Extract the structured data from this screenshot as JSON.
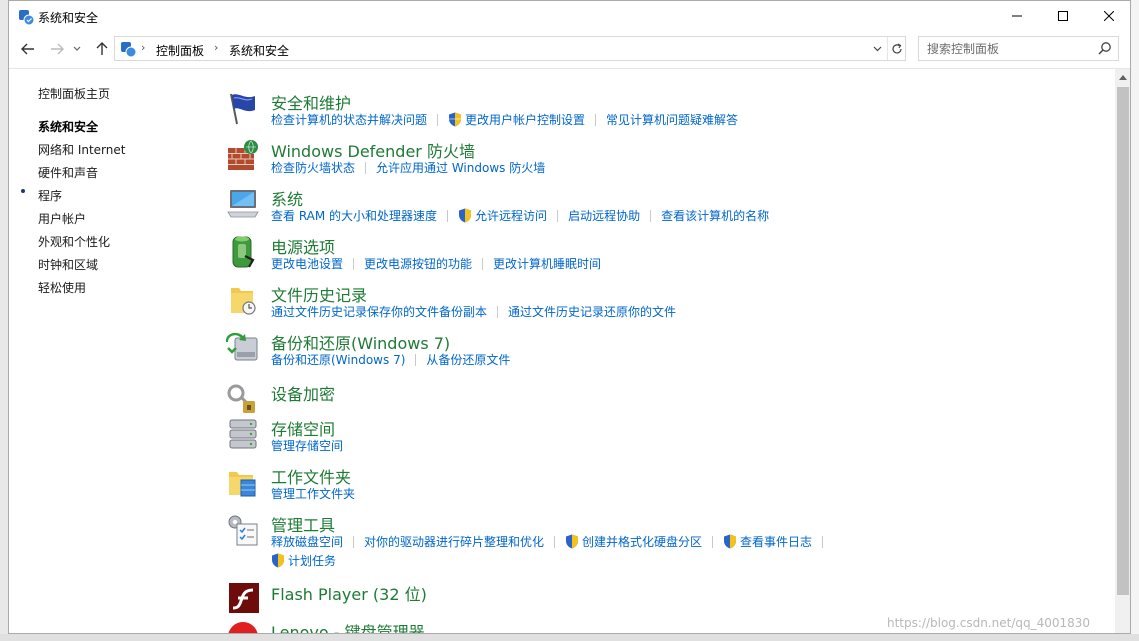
{
  "window": {
    "title": "系统和安全"
  },
  "address": {
    "crumbs": [
      "控制面板",
      "系统和安全"
    ]
  },
  "search": {
    "placeholder": "搜索控制面板"
  },
  "leftnav": {
    "home": "控制面板主页",
    "items": [
      "系统和安全",
      "网络和 Internet",
      "硬件和声音",
      "程序",
      "用户帐户",
      "外观和个性化",
      "时钟和区域",
      "轻松使用"
    ],
    "current_index": 0
  },
  "categories": [
    {
      "title": "安全和维护",
      "icon": "flag-icon",
      "links": [
        {
          "text": "检查计算机的状态并解决问题",
          "shield": false
        },
        {
          "text": "更改用户帐户控制设置",
          "shield": true
        },
        {
          "text": "常见计算机问题疑难解答",
          "shield": false
        }
      ]
    },
    {
      "title": "Windows Defender 防火墙",
      "icon": "firewall-icon",
      "links": [
        {
          "text": "检查防火墙状态",
          "shield": false
        },
        {
          "text": "允许应用通过 Windows 防火墙",
          "shield": false
        }
      ]
    },
    {
      "title": "系统",
      "icon": "computer-icon",
      "links": [
        {
          "text": "查看 RAM 的大小和处理器速度",
          "shield": false
        },
        {
          "text": "允许远程访问",
          "shield": true
        },
        {
          "text": "启动远程协助",
          "shield": false
        },
        {
          "text": "查看该计算机的名称",
          "shield": false
        }
      ]
    },
    {
      "title": "电源选项",
      "icon": "battery-icon",
      "links": [
        {
          "text": "更改电池设置",
          "shield": false
        },
        {
          "text": "更改电源按钮的功能",
          "shield": false
        },
        {
          "text": "更改计算机睡眠时间",
          "shield": false
        }
      ]
    },
    {
      "title": "文件历史记录",
      "icon": "file-history-icon",
      "links": [
        {
          "text": "通过文件历史记录保存你的文件备份副本",
          "shield": false
        },
        {
          "text": "通过文件历史记录还原你的文件",
          "shield": false
        }
      ]
    },
    {
      "title": "备份和还原(Windows 7)",
      "icon": "backup-icon",
      "links": [
        {
          "text": "备份和还原(Windows 7)",
          "shield": false
        },
        {
          "text": "从备份还原文件",
          "shield": false
        }
      ]
    },
    {
      "title": "设备加密",
      "icon": "encryption-key-icon",
      "links": []
    },
    {
      "title": "存储空间",
      "icon": "storage-icon",
      "links": [
        {
          "text": "管理存储空间",
          "shield": false
        }
      ]
    },
    {
      "title": "工作文件夹",
      "icon": "work-folders-icon",
      "links": [
        {
          "text": "管理工作文件夹",
          "shield": false
        }
      ]
    },
    {
      "title": "管理工具",
      "icon": "admin-tools-icon",
      "links": [
        {
          "text": "释放磁盘空间",
          "shield": false
        },
        {
          "text": "对你的驱动器进行碎片整理和优化",
          "shield": false
        },
        {
          "text": "创建并格式化硬盘分区",
          "shield": true
        },
        {
          "text": "查看事件日志",
          "shield": true
        }
      ],
      "links2": [
        {
          "text": "计划任务",
          "shield": true
        }
      ]
    },
    {
      "title": "Flash Player (32 位)",
      "icon": "flash-icon",
      "links": []
    },
    {
      "title": "Lenovo - 键盘管理器",
      "icon": "lenovo-keyboard-icon",
      "links": []
    }
  ],
  "watermark": "https://blog.csdn.net/qq_4001830"
}
